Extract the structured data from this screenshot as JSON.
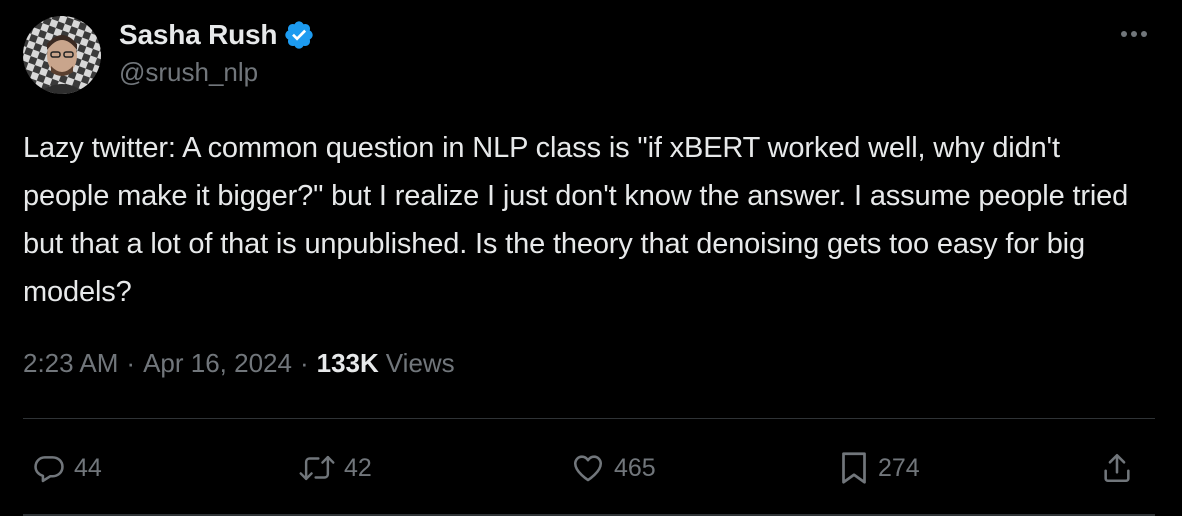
{
  "author": {
    "display_name": "Sasha Rush",
    "handle": "@srush_nlp",
    "verified": true
  },
  "tweet": {
    "text": "Lazy twitter: A common question in NLP class is \"if xBERT worked well, why didn't people make it bigger?\" but I realize I just don't know the answer. I assume people tried but that a lot of that is unpublished. Is the theory that denoising gets too easy for big models?",
    "time": "2:23 AM",
    "date": "Apr 16, 2024",
    "separator": "·",
    "views_count": "133K",
    "views_label": "Views"
  },
  "actions": {
    "replies": "44",
    "reposts": "42",
    "likes": "465",
    "bookmarks": "274"
  },
  "icons": {
    "more": "more-horizontal-icon",
    "verified": "verified-badge-icon",
    "reply": "reply-icon",
    "repost": "repost-icon",
    "like": "heart-icon",
    "bookmark": "bookmark-icon",
    "share": "share-icon"
  },
  "colors": {
    "background": "#000000",
    "text_primary": "#e7e9ea",
    "text_secondary": "#71767b",
    "verified_blue": "#1d9bf0",
    "divider": "#2f3336"
  }
}
